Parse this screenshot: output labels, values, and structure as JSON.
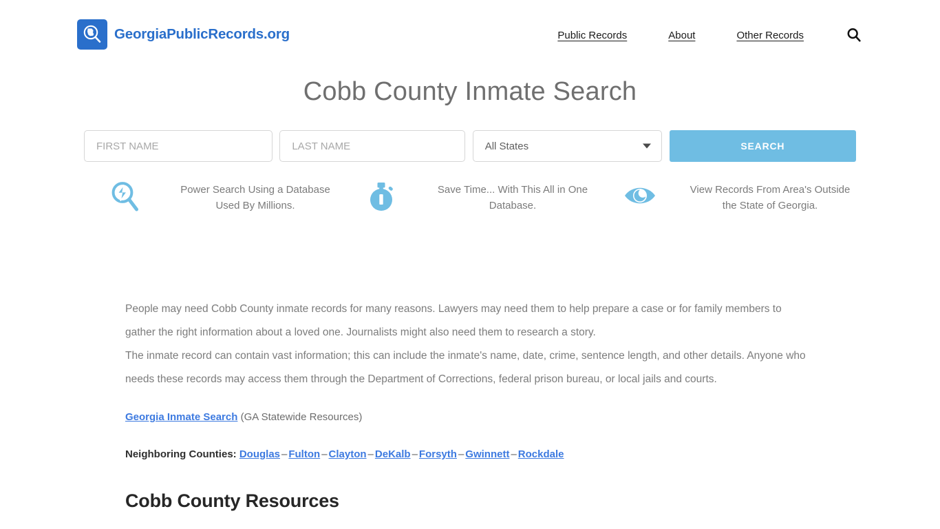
{
  "header": {
    "brand": {
      "logo_icon": "georgia-magnifier-logo-icon",
      "text": "GeorgiaPublicRecords.org",
      "logo_bg": "#2a6fcb",
      "text_color": "#2a6fcb"
    },
    "nav": [
      {
        "label": "Public Records"
      },
      {
        "label": "About"
      },
      {
        "label": "Other Records"
      }
    ],
    "search_icon": "search-icon"
  },
  "page_title": "Cobb County Inmate Search",
  "search_form": {
    "first_name": {
      "value": "",
      "placeholder": "FIRST NAME"
    },
    "last_name": {
      "value": "",
      "placeholder": "LAST NAME"
    },
    "state_select": {
      "selected": "All States",
      "options": [
        "All States"
      ],
      "caret_icon": "chevron-down-icon"
    },
    "submit_label": "SEARCH",
    "submit_color": "#6fbde3"
  },
  "features": [
    {
      "icon": "power-search-magnifier-icon",
      "text": "Power Search Using a Database Used By Millions."
    },
    {
      "icon": "stopwatch-icon",
      "text": "Save Time... With This All in One Database."
    },
    {
      "icon": "eye-icon",
      "text": "View Records From Area's Outside the State of Georgia."
    }
  ],
  "content": {
    "paragraph_1": "People may need Cobb County inmate records for many reasons. Lawyers may need them to help prepare a case or for family members to gather the right information about a loved one. Journalists might also need them to research a story.",
    "paragraph_2": "The inmate record can contain vast information; this can include the inmate's name, date, crime, sentence length, and other details. Anyone who needs these records may access them through the Department of Corrections, federal prison bureau, or local jails and courts.",
    "statewide": {
      "link_label": "Georgia Inmate Search",
      "suffix": " (GA Statewide Resources)"
    },
    "neighboring": {
      "label": "Neighboring Counties: ",
      "separator": "–",
      "counties": [
        "Douglas",
        "Fulton",
        "Clayton",
        "DeKalb",
        "Forsyth",
        "Gwinnett",
        "Rockdale"
      ]
    }
  },
  "section_heading": "Cobb County Resources",
  "colors": {
    "link_blue": "#3d7ae0",
    "accent_blue": "#6fbde3",
    "brand_blue": "#2a6fcb",
    "body_text": "#7c7c7c",
    "title_gray": "#6f6f6f"
  }
}
